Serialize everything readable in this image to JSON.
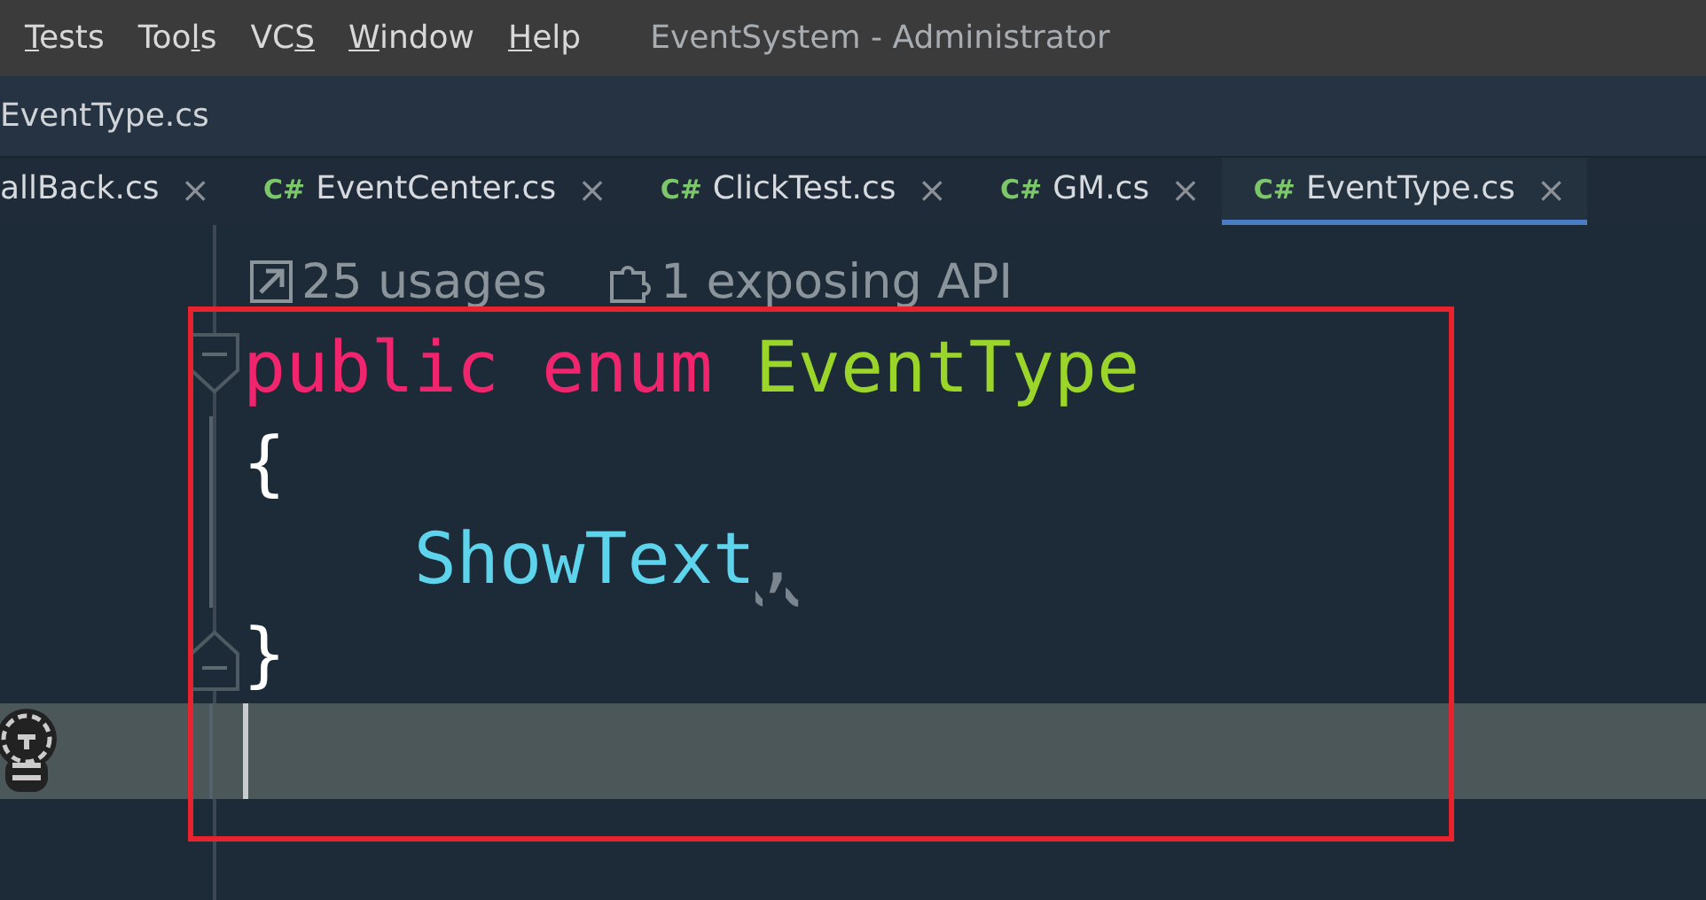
{
  "menu": [
    {
      "parts": [
        {
          "text": "T",
          "underlined": true
        },
        {
          "text": "ests",
          "underlined": false
        }
      ]
    },
    {
      "parts": [
        {
          "text": "Too",
          "underlined": false
        },
        {
          "text": "l",
          "underlined": true
        },
        {
          "text": "s",
          "underlined": false
        }
      ]
    },
    {
      "parts": [
        {
          "text": "VC",
          "underlined": false
        },
        {
          "text": "S",
          "underlined": true
        }
      ]
    },
    {
      "parts": [
        {
          "text": "W",
          "underlined": true
        },
        {
          "text": "indow",
          "underlined": false
        }
      ]
    },
    {
      "parts": [
        {
          "text": "H",
          "underlined": true
        },
        {
          "text": "elp",
          "underlined": false
        }
      ]
    }
  ],
  "window": {
    "title": "EventSystem - Administrator"
  },
  "breadcrumb": "EventType.cs",
  "tabs": [
    {
      "label": "allBack.cs",
      "selected": false,
      "close": "×"
    },
    {
      "label": "EventCenter.cs",
      "badge": "C#",
      "selected": false,
      "close": "×"
    },
    {
      "label": "ClickTest.cs",
      "badge": "C#",
      "selected": false,
      "close": "×"
    },
    {
      "label": "GM.cs",
      "badge": "C#",
      "selected": false,
      "close": "×"
    },
    {
      "label": "EventType.cs",
      "badge": "C#",
      "selected": true,
      "close": "×"
    }
  ],
  "inlay_hints": [
    {
      "kind": "usages",
      "text": "25 usages"
    },
    {
      "kind": "api",
      "text": "1 exposing API"
    }
  ],
  "code_lines": [
    {
      "fold_start": true,
      "fold_end": false,
      "current": false,
      "tokens": [
        {
          "kind": "keyword",
          "text": "public"
        },
        {
          "kind": "keyword",
          "text": "enum"
        },
        {
          "kind": "type",
          "text": "EventType"
        }
      ]
    },
    {
      "fold_start": false,
      "fold_end": false,
      "current": false,
      "tokens": [
        {
          "kind": "punct",
          "text": "{"
        }
      ]
    },
    {
      "fold_start": false,
      "fold_end": false,
      "current": false,
      "tokens": [
        {
          "kind": "member",
          "text": "    ShowText"
        },
        {
          "kind": "warn",
          "text": ","
        }
      ]
    },
    {
      "fold_start": false,
      "fold_end": true,
      "current": false,
      "tokens": [
        {
          "kind": "punct",
          "text": "}"
        }
      ]
    },
    {
      "fold_start": false,
      "fold_end": false,
      "current": true
    }
  ]
}
